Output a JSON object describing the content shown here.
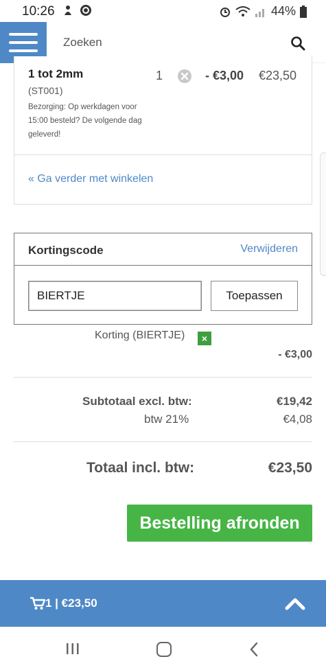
{
  "status_bar": {
    "time": "10:26",
    "battery": "44%"
  },
  "header": {
    "search_label": "Zoeken"
  },
  "cart_item": {
    "title": "1 tot 2mm",
    "sku": "(ST001)",
    "delivery_note": "Bezorging: Op werkdagen voor 15:00 besteld? De volgende dag geleverd!",
    "quantity": "1",
    "discount": "- €3,00",
    "price": "€23,50"
  },
  "continue_link": "« Ga verder met winkelen",
  "coupon": {
    "title": "Kortingscode",
    "remove_label": "Verwijderen",
    "code_value": "BIERTJE",
    "apply_label": "Toepassen"
  },
  "totals": {
    "discount_label": "Korting (BIERTJE)",
    "discount_remove_glyph": "×",
    "discount_amount": "- €3,00",
    "subtotal_label": "Subtotaal excl. btw:",
    "subtotal_value": "€19,42",
    "vat_label": "btw 21%",
    "vat_value": "€4,08",
    "total_label": "Totaal incl. btw:",
    "total_value": "€23,50"
  },
  "checkout_label": "Bestelling afronden",
  "cart_bar": {
    "summary": "1 | €23,50"
  },
  "colors": {
    "accent_blue": "#4f88c6",
    "checkout_green": "#46b546",
    "remove_green": "#3f9e3f"
  },
  "icons": [
    "menu-icon",
    "search-icon",
    "remove-item-icon",
    "remove-discount-icon",
    "cart-icon",
    "chevron-up-icon",
    "recent-apps-icon",
    "home-icon",
    "back-icon"
  ]
}
